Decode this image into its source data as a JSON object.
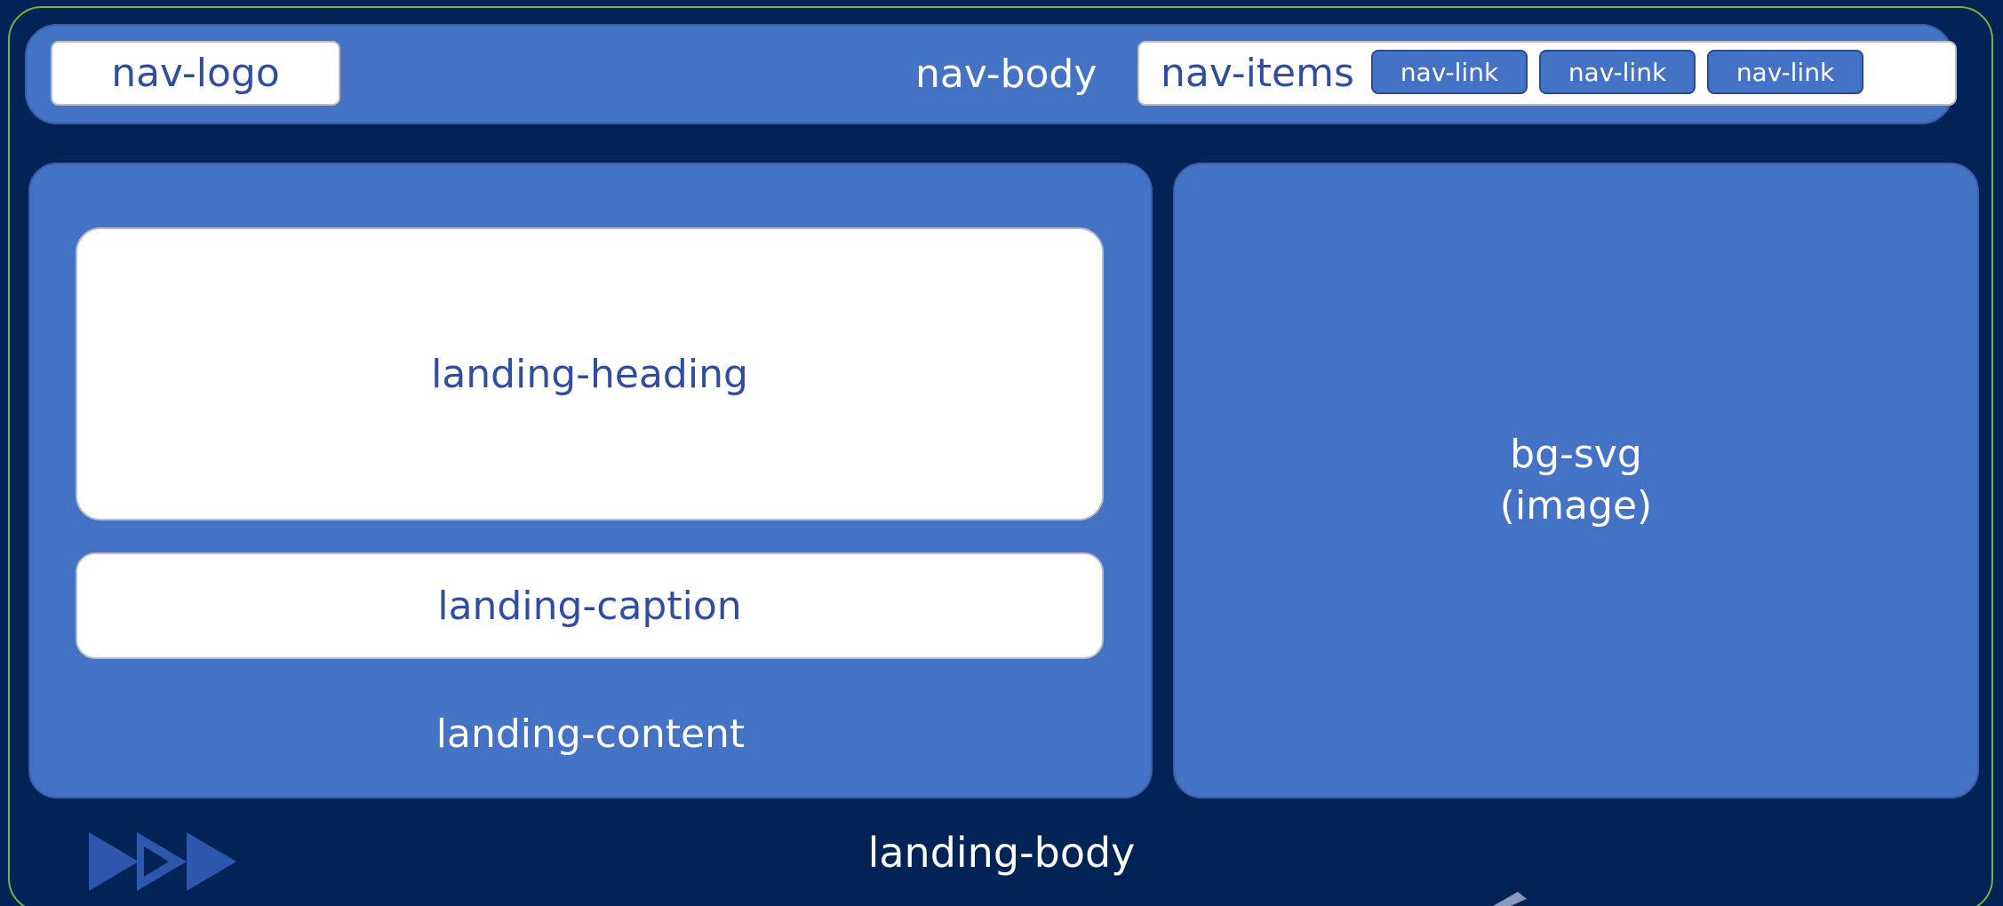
{
  "colors": {
    "background": "#012355",
    "box_blue": "#4472c4",
    "box_white": "#ffffff",
    "text_blue": "#2f4ea2",
    "outer_border": "#7fae3a"
  },
  "nav": {
    "body_label": "nav-body",
    "logo_label": "nav-logo",
    "items_label": "nav-items",
    "links": [
      "nav-link",
      "nav-link",
      "nav-link"
    ]
  },
  "landing": {
    "heading_label": "landing-heading",
    "caption_label": "landing-caption",
    "content_label": "landing-content",
    "body_label": "landing-body"
  },
  "image": {
    "label_line1": "bg-svg",
    "label_line2": "(image)"
  },
  "decor": {
    "triangles_icon": "triple-play-arrows-icon"
  }
}
